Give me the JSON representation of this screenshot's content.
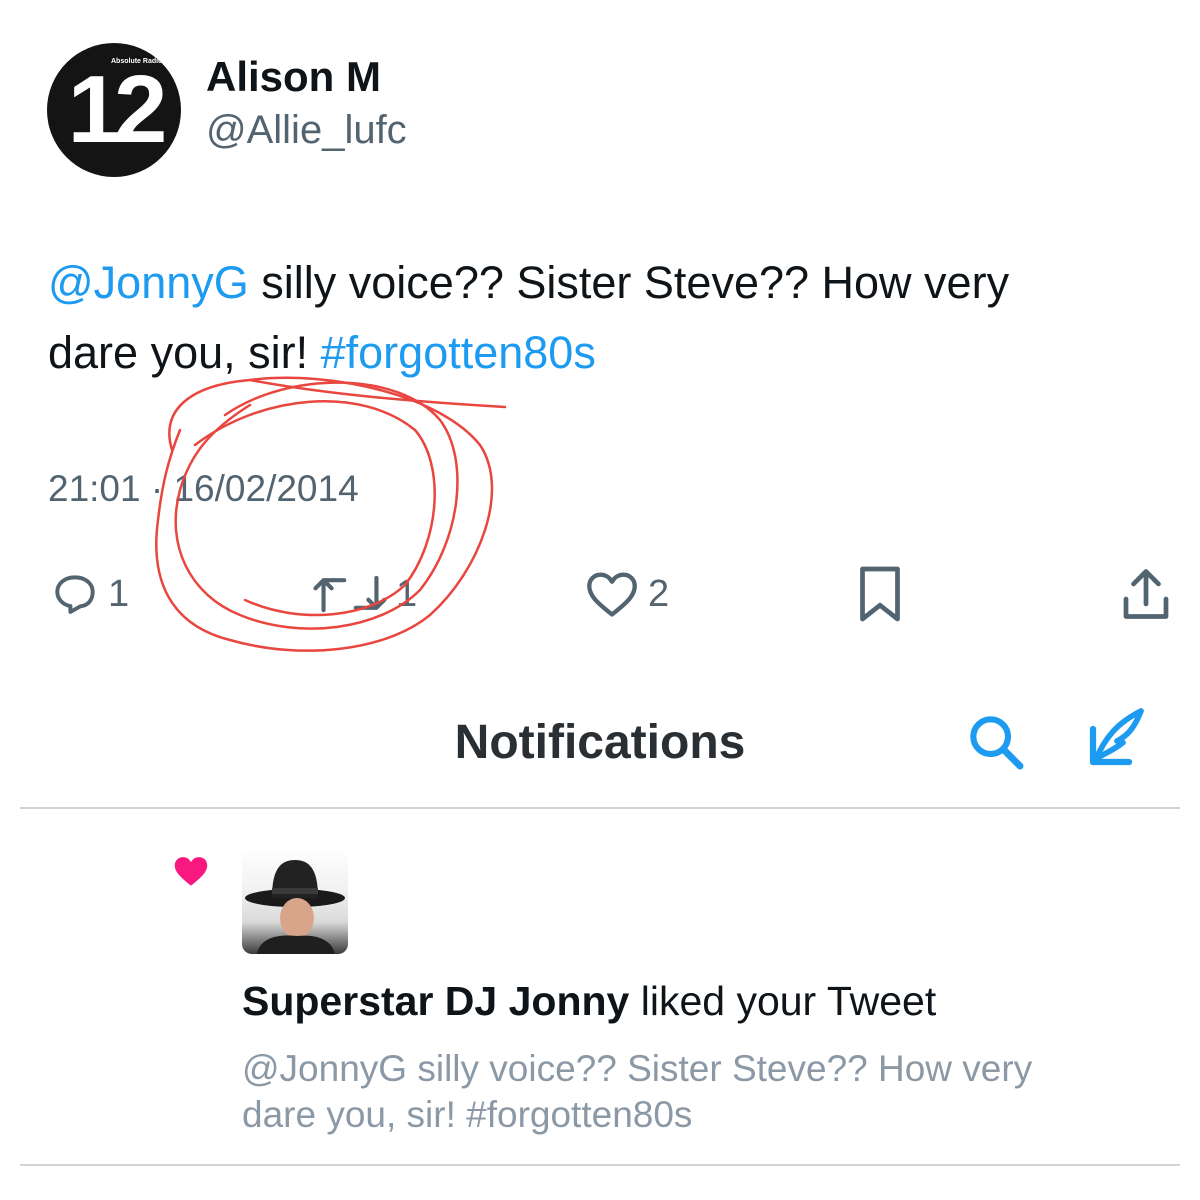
{
  "tweet": {
    "display_name": "Alison M",
    "handle": "@Allie_lufc",
    "avatar": {
      "number": "12",
      "brand": "Absolute Radio 80s"
    },
    "text": {
      "mention": "@JonnyG",
      "body_line1": " silly voice?? Sister Steve?? How very",
      "body_line2": "dare you, sir! ",
      "hashtag": "#forgotten80s"
    },
    "time": "21:01",
    "separator": "·",
    "date": "16/02/2014",
    "actions": {
      "reply_icon": "reply-icon",
      "reply_count": "1",
      "retweet_icon": "retweet-icon",
      "retweet_count": "1",
      "like_icon": "heart-outline-icon",
      "like_count": "2",
      "bookmark_icon": "bookmark-icon",
      "share_icon": "share-icon"
    }
  },
  "notifications": {
    "title": "Notifications",
    "search_icon": "search-icon",
    "compose_icon": "compose-tweet-icon",
    "items": [
      {
        "type_icon": "heart-filled-icon",
        "user_name": "Superstar DJ Jonny",
        "action_text": " liked your Tweet",
        "tweet_preview_line1": "@JonnyG silly voice?? Sister Steve?? How very",
        "tweet_preview_line2": "dare you, sir! #forgotten80s"
      }
    ]
  },
  "colors": {
    "accent": "#1d9bf0",
    "like_red": "#f91880",
    "annotation_red": "#e8463f",
    "secondary_text": "#536471"
  }
}
